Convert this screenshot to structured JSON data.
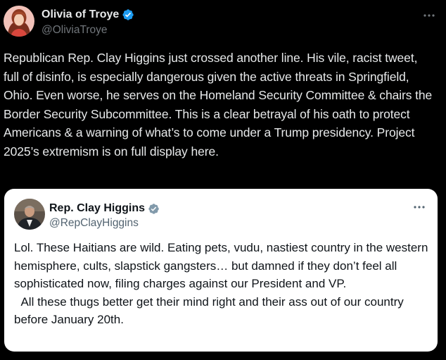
{
  "post": {
    "author": {
      "display_name": "Olivia of Troye",
      "handle": "@OliviaTroye",
      "verified": true,
      "verified_color": "#1d9bf0"
    },
    "more_icon": "more-horizontal-icon",
    "text": "Republican Rep. Clay Higgins just crossed another line. His vile, racist tweet, full of disinfo, is especially dangerous given the active threats in Springfield, Ohio. Even worse, he serves on the Homeland Security Committee & chairs the Border Security Subcommittee. This is a clear betrayal of his oath to protect Americans & a warning of what’s to come under a Trump presidency. Project 2025’s extremism is on full display here."
  },
  "quoted_post": {
    "author": {
      "display_name": "Rep. Clay Higgins",
      "handle": "@RepClayHiggins",
      "verified": true,
      "verified_color": "#829aab"
    },
    "more_icon": "more-horizontal-icon",
    "text": "Lol. These Haitians are wild. Eating pets, vudu, nastiest country in the western hemisphere, cults, slapstick gangsters… but damned if they don’t feel all sophisticated now, filing charges against our President and VP.\n  All these thugs better get their mind right and their ass out of our country before January 20th."
  },
  "theme": {
    "background": "#000000",
    "text_primary": "#e7e9ea",
    "text_secondary": "#71767b",
    "quote_background": "#ffffff"
  }
}
